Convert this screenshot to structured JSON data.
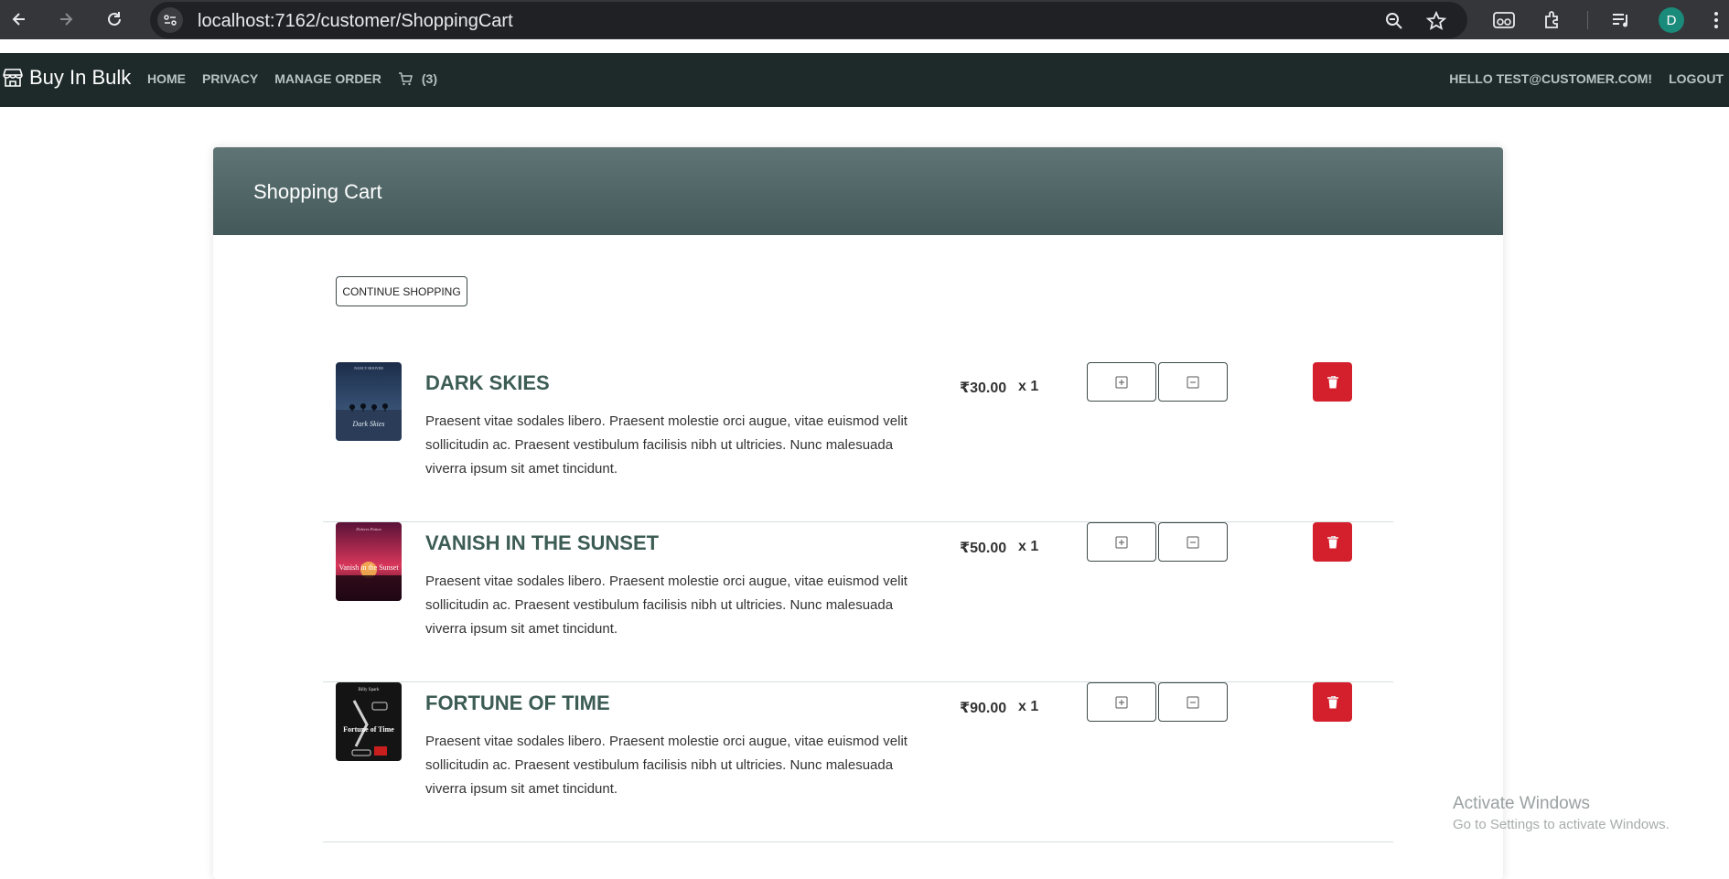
{
  "browser": {
    "url": "localhost:7162/customer/ShoppingCart",
    "profile_initial": "D"
  },
  "navbar": {
    "brand": "Buy In Bulk",
    "links": [
      "HOME",
      "PRIVACY",
      "MANAGE ORDER"
    ],
    "cart_count": "(3)",
    "greeting": "HELLO TEST@CUSTOMER.COM!",
    "logout": "LOGOUT"
  },
  "cart": {
    "title": "Shopping Cart",
    "continue_label": "CONTINUE SHOPPING",
    "items": [
      {
        "title": "DARK SKIES",
        "description": "Praesent vitae sodales libero. Praesent molestie orci augue, vitae euismod velit sollicitudin ac. Praesent vestibulum facilisis nibh ut ultricies. Nunc malesuada viverra ipsum sit amet tincidunt.",
        "price": "₹30.00",
        "quantity": "x 1",
        "cover_author": "NANCY HOOVER",
        "cover_title": "Dark Skies",
        "cover_colors": [
          "#1c2d4a",
          "#3a5a7e"
        ]
      },
      {
        "title": "VANISH IN THE SUNSET",
        "description": "Praesent vitae sodales libero. Praesent molestie orci augue, vitae euismod velit sollicitudin ac. Praesent vestibulum facilisis nibh ut ultricies. Nunc malesuada viverra ipsum sit amet tincidunt.",
        "price": "₹50.00",
        "quantity": "x 1",
        "cover_author": "Dolores Patton",
        "cover_title": "Vanish in the Sunset",
        "cover_colors": [
          "#6a1540",
          "#d8365a"
        ]
      },
      {
        "title": "FORTUNE OF TIME",
        "description": "Praesent vitae sodales libero. Praesent molestie orci augue, vitae euismod velit sollicitudin ac. Praesent vestibulum facilisis nibh ut ultricies. Nunc malesuada viverra ipsum sit amet tincidunt.",
        "price": "₹90.00",
        "quantity": "x 1",
        "cover_author": "Billy Spark",
        "cover_title": "Fortune of Time",
        "cover_colors": [
          "#141414",
          "#3a3a3a"
        ]
      }
    ]
  },
  "watermark": {
    "line1": "Activate Windows",
    "line2": "Go to Settings to activate Windows."
  },
  "colors": {
    "navbar_bg": "#1e2a2a",
    "header_gradient_top": "#5f7475",
    "title_green": "#3c5c54",
    "delete_red": "#d41f2c"
  }
}
